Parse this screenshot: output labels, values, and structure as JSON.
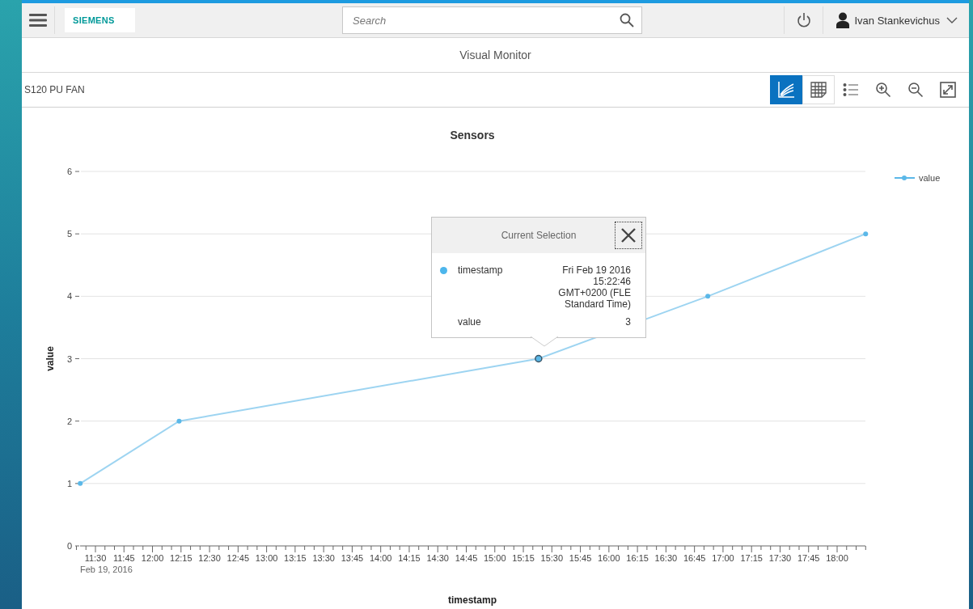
{
  "header": {
    "brand": "SIEMENS",
    "search": {
      "placeholder": "Search"
    },
    "user": "Ivan Stankevichus"
  },
  "page_title": "Visual Monitor",
  "device": "S120 PU FAN",
  "toolbar": [
    {
      "kind": "chart",
      "selected": true
    },
    {
      "kind": "table",
      "selected": false
    },
    {
      "kind": "legend"
    },
    {
      "kind": "zoom-in"
    },
    {
      "kind": "zoom-out"
    },
    {
      "kind": "expand"
    }
  ],
  "chart": {
    "date_label": "Feb 19, 2016",
    "chart_data": {
      "type": "line",
      "title": "Sensors",
      "xlabel": "timestamp",
      "ylabel": "value",
      "x": [
        682,
        734,
        923,
        1012,
        1095
      ],
      "series": [
        {
          "name": "value",
          "color": "#5bb8e8",
          "values": [
            1,
            2,
            3,
            4,
            5
          ],
          "marker": true
        }
      ],
      "grid": true,
      "xlim": [
        680,
        1096
      ],
      "ylim": [
        0,
        6
      ],
      "xticks": [
        {
          "value": 690,
          "label": "11:30"
        },
        {
          "value": 705,
          "label": "11:45"
        },
        {
          "value": 720,
          "label": "12:00"
        },
        {
          "value": 735,
          "label": "12:15"
        },
        {
          "value": 750,
          "label": "12:30"
        },
        {
          "value": 765,
          "label": "12:45"
        },
        {
          "value": 780,
          "label": "13:00"
        },
        {
          "value": 795,
          "label": "13:15"
        },
        {
          "value": 810,
          "label": "13:30"
        },
        {
          "value": 825,
          "label": "13:45"
        },
        {
          "value": 840,
          "label": "14:00"
        },
        {
          "value": 855,
          "label": "14:15"
        },
        {
          "value": 870,
          "label": "14:30"
        },
        {
          "value": 885,
          "label": "14:45"
        },
        {
          "value": 900,
          "label": "15:00"
        },
        {
          "value": 915,
          "label": "15:15"
        },
        {
          "value": 930,
          "label": "15:30"
        },
        {
          "value": 945,
          "label": "15:45"
        },
        {
          "value": 960,
          "label": "16:00"
        },
        {
          "value": 975,
          "label": "16:15"
        },
        {
          "value": 990,
          "label": "16:30"
        },
        {
          "value": 1005,
          "label": "16:45"
        },
        {
          "value": 1020,
          "label": "17:00"
        },
        {
          "value": 1035,
          "label": "17:15"
        },
        {
          "value": 1050,
          "label": "17:30"
        },
        {
          "value": 1065,
          "label": "17:45"
        },
        {
          "value": 1080,
          "label": "18:00"
        }
      ],
      "yticks": [
        0,
        1,
        2,
        3,
        4,
        5,
        6
      ]
    },
    "points": [
      {
        "selected": false
      },
      {
        "selected": false
      },
      {
        "selected": true
      },
      {
        "selected": false
      },
      {
        "selected": false
      }
    ]
  },
  "tooltip": {
    "title": "Current Selection",
    "rows": [
      {
        "label": "timestamp",
        "value": "Fri Feb 19 2016 15:22:46 GMT+0200 (FLE Standard Time)",
        "marker": true
      },
      {
        "label": "value",
        "value": "3",
        "marker": false
      }
    ]
  }
}
